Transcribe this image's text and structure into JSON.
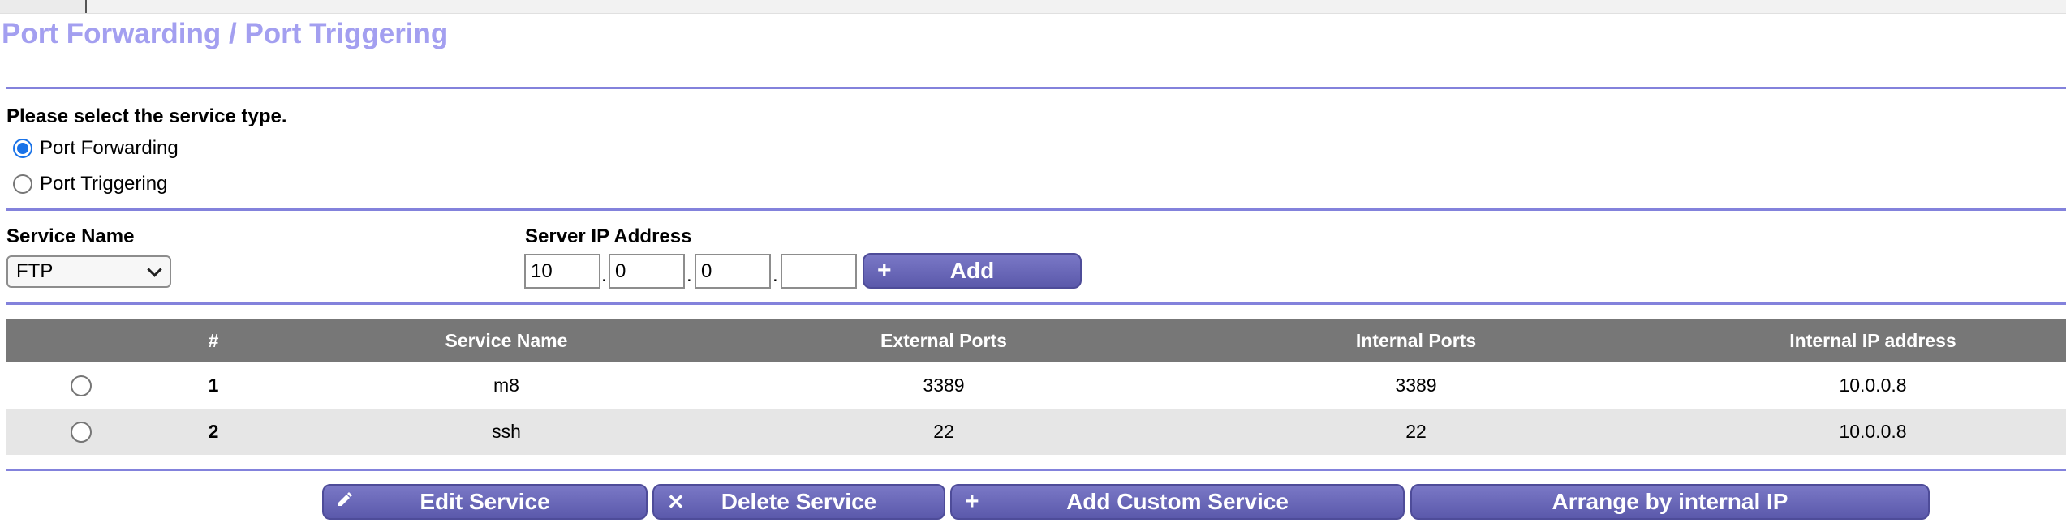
{
  "page": {
    "title": "Port Forwarding / Port Triggering"
  },
  "service_type": {
    "prompt": "Please select the service type.",
    "options": [
      {
        "label": "Port Forwarding",
        "checked": true
      },
      {
        "label": "Port Triggering",
        "checked": false
      }
    ]
  },
  "form": {
    "service_name_label": "Service Name",
    "service_name_value": "FTP",
    "server_ip_label": "Server IP Address",
    "ip_octets": [
      "10",
      "0",
      "0",
      ""
    ],
    "ip_separator": ".",
    "add_button": {
      "icon": "+",
      "label": "Add"
    }
  },
  "table": {
    "headers": [
      "#",
      "Service Name",
      "External Ports",
      "Internal Ports",
      "Internal IP address"
    ],
    "rows": [
      {
        "num": "1",
        "service_name": "m8",
        "external_ports": "3389",
        "internal_ports": "3389",
        "internal_ip": "10.0.0.8"
      },
      {
        "num": "2",
        "service_name": "ssh",
        "external_ports": "22",
        "internal_ports": "22",
        "internal_ip": "10.0.0.8"
      }
    ]
  },
  "actions": {
    "edit": {
      "icon": "pencil-icon",
      "label": "Edit Service"
    },
    "delete": {
      "icon": "close-icon",
      "icon_glyph": "✕",
      "label": "Delete Service"
    },
    "add_custom": {
      "icon": "plus-icon",
      "icon_glyph": "+",
      "label": "Add Custom Service"
    },
    "arrange": {
      "label": "Arrange by internal IP"
    }
  },
  "colors": {
    "title": "#a39ff0",
    "divider": "#8382dc",
    "button": "#6462b5",
    "table_header": "#777777",
    "row_alt": "#e6e6e6",
    "radio_checked": "#1a73e8"
  }
}
